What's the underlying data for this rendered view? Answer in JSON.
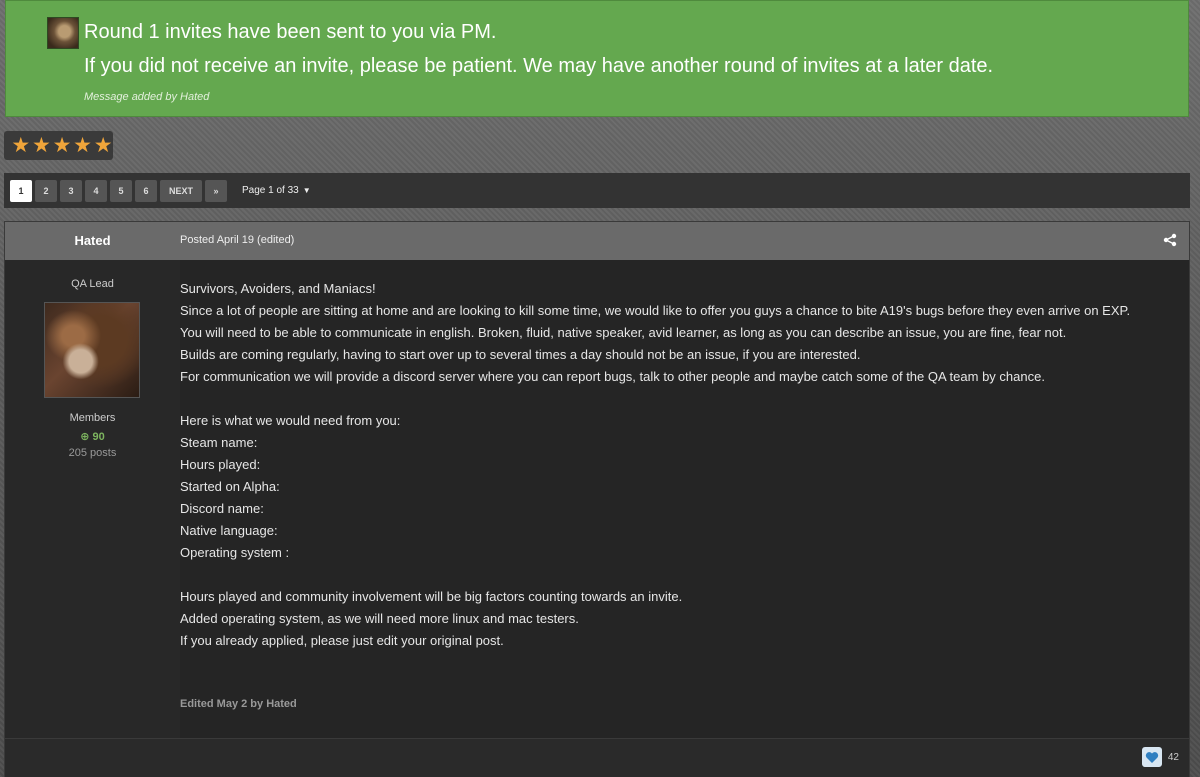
{
  "announcement": {
    "line1": "Round 1 invites have been sent to you via PM.",
    "line2": "If you did not receive an invite, please be patient. We may have another round of invites at a later date.",
    "meta": "Message added by Hated"
  },
  "rating": {
    "stars": 5,
    "max": 5,
    "color": "#f0a53a"
  },
  "pagination": {
    "pages": [
      "1",
      "2",
      "3",
      "4",
      "5",
      "6"
    ],
    "active": "1",
    "next_label": "NEXT",
    "last_label": "»",
    "page_of": "Page 1 of 33"
  },
  "post": {
    "author": "Hated",
    "posted": "Posted April 19 (edited)",
    "role": "QA Lead",
    "group": "Members",
    "reputation": "90",
    "post_count": "205 posts",
    "body": [
      "Survivors, Avoiders, and Maniacs!",
      "Since a lot of people are sitting at home and are looking to kill some time, we would like to offer you guys a chance to bite A19's bugs before they even arrive on EXP.",
      "You will need to be able to communicate in english. Broken, fluid, native speaker, avid learner, as long as you can describe an issue, you are fine, fear not.",
      "Builds are coming regularly, having to start over up to several times a day should not be an issue, if you are interested.",
      "For communication we will provide a discord server where you can report bugs, talk to other people and maybe catch some of the QA team by chance.",
      "",
      "Here is what we would need from you:",
      "Steam name:",
      "Hours played:",
      "Started on Alpha:",
      "Discord name:",
      "Native language:",
      "Operating system :",
      "",
      "Hours played and community involvement will be big factors counting towards an invite.",
      "Added operating system, as we will need more linux and mac testers.",
      "If you already applied, please just edit your original post."
    ],
    "edited": "Edited May 2 by Hated",
    "likes": "42"
  },
  "colors": {
    "announcement_bg": "#64a84f",
    "reputation": "#7db55f",
    "star": "#f0a53a"
  }
}
